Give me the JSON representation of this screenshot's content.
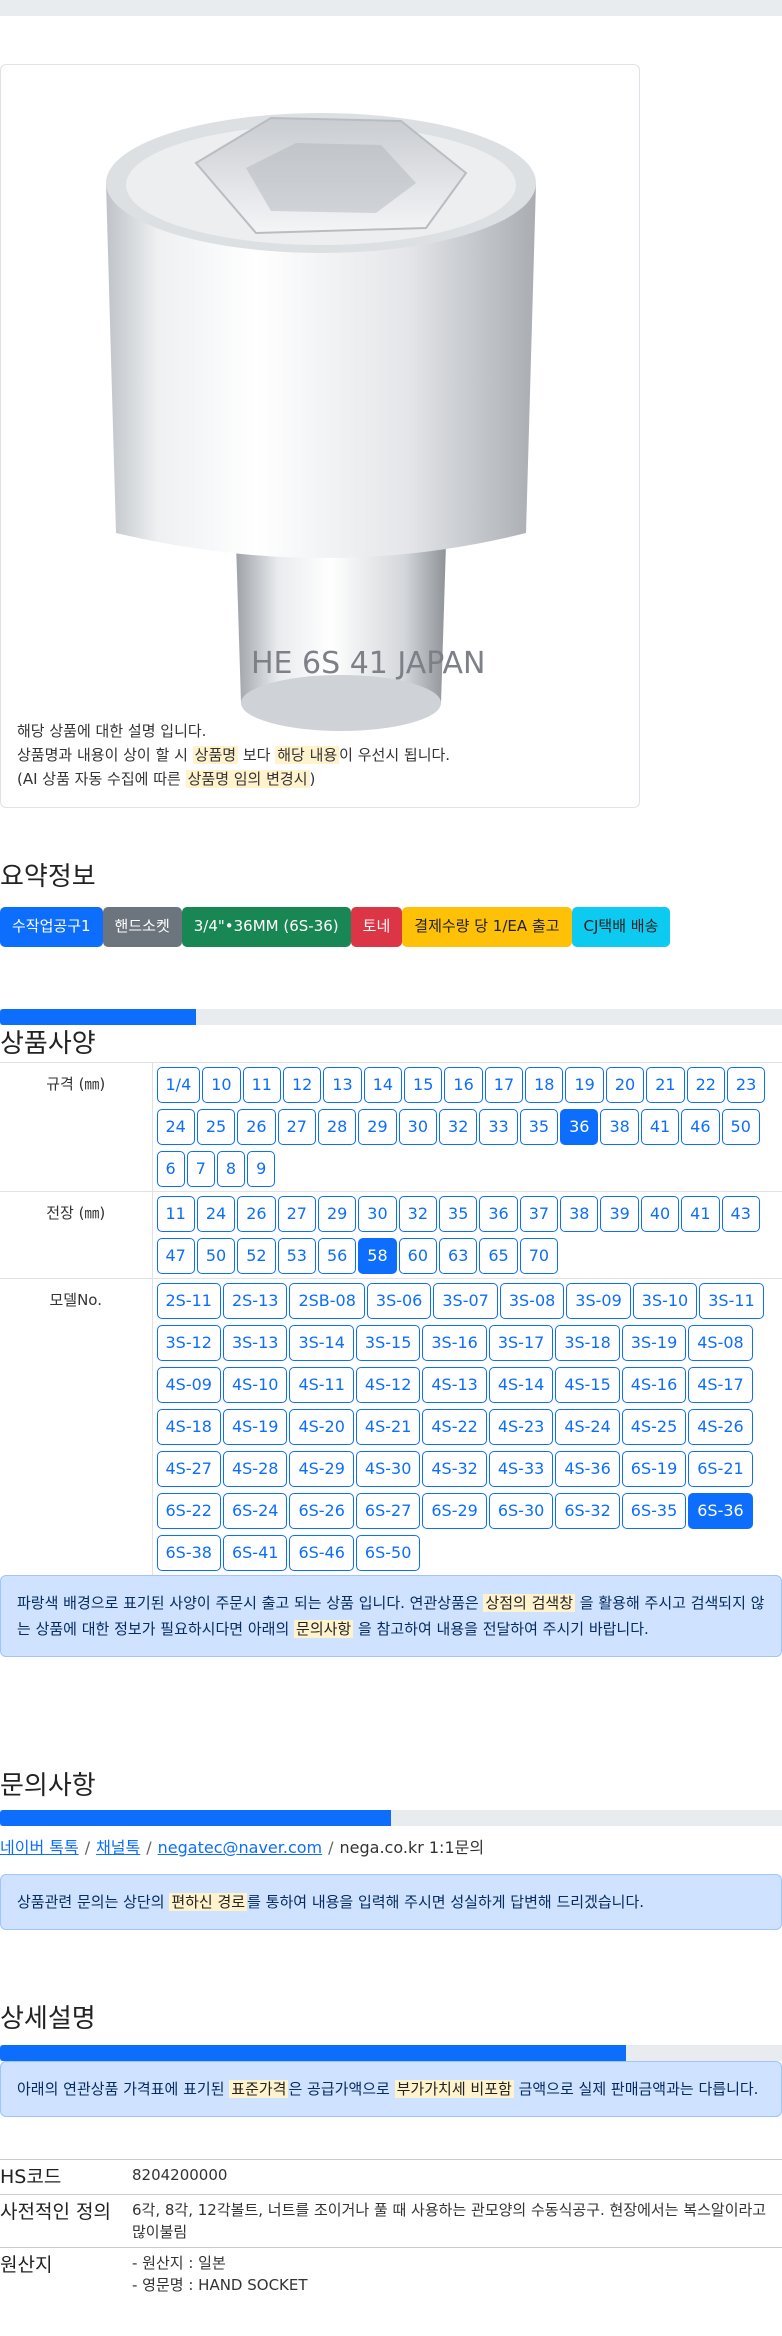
{
  "product": {
    "caption_line1": "해당 상품에 대한 설명 입니다.",
    "caption_line2_pre": "상품명과 내용이 상이 할 시 ",
    "caption_line2_hl1": "상품명",
    "caption_line2_mid": " 보다 ",
    "caption_line2_hl2": "해당 내용",
    "caption_line2_post": "이 우선시 됩니다.",
    "caption_line3_pre": "(AI 상품 자동 수집에 따른 ",
    "caption_line3_hl": "상품명 임의 변경시",
    "caption_line3_post": ")",
    "photo_mark": "HE 6S 41 JAPAN"
  },
  "summary": {
    "title": "요약정보",
    "badges": [
      {
        "label": "수작업공구1",
        "color": "#0d6efd"
      },
      {
        "label": "핸드소켓",
        "color": "#6c757d"
      },
      {
        "label": "3/4\"•36MM (6S-36)",
        "color": "#198754"
      },
      {
        "label": "토네",
        "color": "#dc3545"
      },
      {
        "label": "결제수량 당 1/EA 출고",
        "color": "#ffc107",
        "text": "#222222"
      },
      {
        "label": "CJ택배 배송",
        "color": "#0dcaf0",
        "text": "#222222"
      }
    ]
  },
  "specs": {
    "title": "상품사양",
    "progress": 0.25,
    "rows": [
      {
        "label": "규격 (㎜)",
        "selected": "36",
        "options": [
          "1/4",
          "10",
          "11",
          "12",
          "13",
          "14",
          "15",
          "16",
          "17",
          "18",
          "19",
          "20",
          "21",
          "22",
          "23",
          "24",
          "25",
          "26",
          "27",
          "28",
          "29",
          "30",
          "32",
          "33",
          "35",
          "36",
          "38",
          "41",
          "46",
          "50",
          "6",
          "7",
          "8",
          "9"
        ]
      },
      {
        "label": "전장 (㎜)",
        "selected": "58",
        "options": [
          "11",
          "24",
          "26",
          "27",
          "29",
          "30",
          "32",
          "35",
          "36",
          "37",
          "38",
          "39",
          "40",
          "41",
          "43",
          "47",
          "50",
          "52",
          "53",
          "56",
          "58",
          "60",
          "63",
          "65",
          "70"
        ]
      },
      {
        "label": "모델No.",
        "selected": "6S-36",
        "options": [
          "2S-11",
          "2S-13",
          "2SB-08",
          "3S-06",
          "3S-07",
          "3S-08",
          "3S-09",
          "3S-10",
          "3S-11",
          "3S-12",
          "3S-13",
          "3S-14",
          "3S-15",
          "3S-16",
          "3S-17",
          "3S-18",
          "3S-19",
          "4S-08",
          "4S-09",
          "4S-10",
          "4S-11",
          "4S-12",
          "4S-13",
          "4S-14",
          "4S-15",
          "4S-16",
          "4S-17",
          "4S-18",
          "4S-19",
          "4S-20",
          "4S-21",
          "4S-22",
          "4S-23",
          "4S-24",
          "4S-25",
          "4S-26",
          "4S-27",
          "4S-28",
          "4S-29",
          "4S-30",
          "4S-32",
          "4S-33",
          "4S-36",
          "6S-19",
          "6S-21",
          "6S-22",
          "6S-24",
          "6S-26",
          "6S-27",
          "6S-29",
          "6S-30",
          "6S-32",
          "6S-35",
          "6S-36",
          "6S-38",
          "6S-41",
          "6S-46",
          "6S-50"
        ]
      }
    ],
    "notice_pre": "파랑색 배경으로 표기된 사양이 주문시 출고 되는 상품 입니다. 연관상품은 ",
    "notice_hl1": "상점의 검색창",
    "notice_mid": " 을 활용해 주시고 검색되지 않는 상품에 대한 정보가 필요하시다면 아래의 ",
    "notice_hl2": "문의사항",
    "notice_post": " 을 참고하여 내용을 전달하여 주시기 바랍니다."
  },
  "inquiry": {
    "title": "문의사항",
    "progress": 0.5,
    "links": [
      "네이버 톡톡",
      "채널톡",
      "negatec@naver.com"
    ],
    "extra": "nega.co.kr 1:1문의",
    "notice_pre": "상품관련 문의는 상단의 ",
    "notice_hl": "편하신 경로",
    "notice_post": "를 통하여 내용을 입력해 주시면 성실하게 답변해 드리겠습니다."
  },
  "detail": {
    "title": "상세설명",
    "progress": 0.8,
    "notice_pre": "아래의 연관상품 가격표에 표기된 ",
    "notice_hl1": "표준가격",
    "notice_mid": "은 공급가액으로 ",
    "notice_hl2": "부가가치세 비포함",
    "notice_post": " 금액으로 실제 판매금액과는 다릅니다.",
    "rows": [
      {
        "k": "HS코드",
        "v": "8204200000"
      },
      {
        "k": "사전적인 정의",
        "v": "6각, 8각, 12각볼트, 너트를 조이거나 풀 때 사용하는 관모양의 수동식공구. 현장에서는 복스알이라고 많이불림"
      },
      {
        "k": "원산지",
        "v1": "- 원산지 : 일본",
        "v2": "- 영문명 : HAND SOCKET"
      }
    ]
  }
}
